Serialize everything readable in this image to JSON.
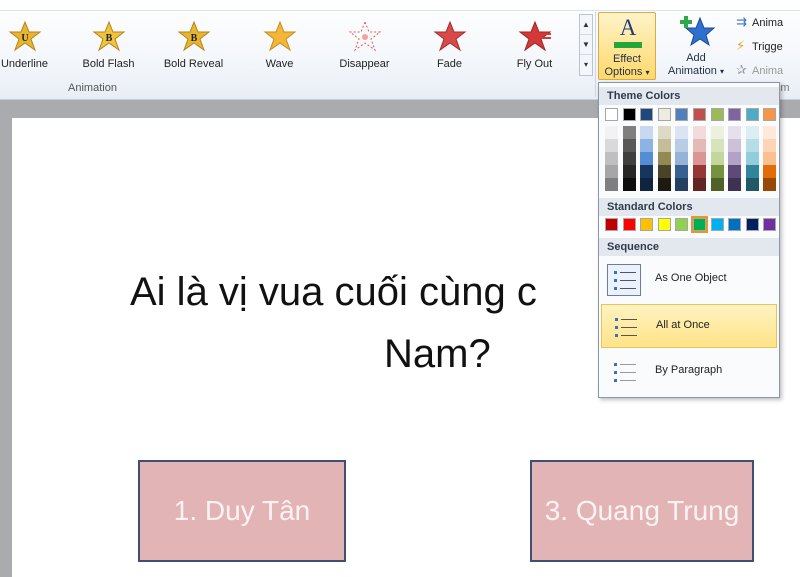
{
  "ribbon": {
    "animations": [
      {
        "label": "Underline",
        "icon": "underline-star-icon",
        "color": "#e8b530"
      },
      {
        "label": "Bold Flash",
        "icon": "bold-flash-star-icon",
        "color": "#e8b530"
      },
      {
        "label": "Bold Reveal",
        "icon": "bold-reveal-star-icon",
        "color": "#e8b530"
      },
      {
        "label": "Wave",
        "icon": "wave-star-icon",
        "color": "#f2b63b"
      },
      {
        "label": "Disappear",
        "icon": "disappear-star-icon",
        "color": "#e05a5a"
      },
      {
        "label": "Fade",
        "icon": "fade-star-icon",
        "color": "#d84a4a"
      },
      {
        "label": "Fly Out",
        "icon": "fly-out-star-icon",
        "color": "#d23a3a"
      }
    ],
    "group_label": "Animation",
    "effect_options": {
      "line1": "Effect",
      "line2": "Options"
    },
    "add_animation": {
      "line1": "Add",
      "line2": "Animation"
    },
    "side_commands": [
      {
        "label": "Anima",
        "icon": "animation-pane-icon",
        "disabled": false
      },
      {
        "label": "Trigge",
        "icon": "trigger-icon",
        "disabled": false
      },
      {
        "label": "Anima",
        "icon": "animation-painter-icon",
        "disabled": true
      }
    ],
    "next_group_label": "m"
  },
  "slide": {
    "title_line1": "Ai là vị vua cuối cùng c",
    "title_line2": "Nam?",
    "answers": [
      "1. Duy Tân",
      "3. Quang Trung"
    ]
  },
  "dropdown": {
    "theme_colors_header": "Theme Colors",
    "theme_colors": [
      "#ffffff",
      "#000000",
      "#1f497d",
      "#eeece1",
      "#4f81bd",
      "#c0504d",
      "#9bbb59",
      "#8064a2",
      "#4bacc6",
      "#f79646"
    ],
    "theme_shades": [
      [
        "#f2f2f2",
        "#d9d9d9",
        "#bfbfbf",
        "#a6a6a6",
        "#7f7f7f"
      ],
      [
        "#7f7f7f",
        "#595959",
        "#3f3f3f",
        "#262626",
        "#0d0d0d"
      ],
      [
        "#c6d9f0",
        "#8db3e2",
        "#548dd4",
        "#17365d",
        "#0f243e"
      ],
      [
        "#ddd9c3",
        "#c4bd97",
        "#938953",
        "#494429",
        "#1d1b10"
      ],
      [
        "#dbe5f1",
        "#b8cce4",
        "#95b3d7",
        "#366092",
        "#244061"
      ],
      [
        "#f2dcdb",
        "#e5b9b7",
        "#d99694",
        "#953734",
        "#632423"
      ],
      [
        "#ebf1dd",
        "#d7e3bc",
        "#c3d69b",
        "#76923c",
        "#4f6128"
      ],
      [
        "#e5e0ec",
        "#ccc1d9",
        "#b2a2c7",
        "#5f497a",
        "#3f3151"
      ],
      [
        "#dbeef3",
        "#b7dde8",
        "#92cddc",
        "#31859b",
        "#205867"
      ],
      [
        "#fdeada",
        "#fbd5b5",
        "#fac08f",
        "#e36c09",
        "#974806"
      ]
    ],
    "standard_colors_header": "Standard Colors",
    "standard_colors": [
      "#c00000",
      "#ff0000",
      "#ffc000",
      "#ffff00",
      "#92d050",
      "#00b050",
      "#00b0f0",
      "#0070c0",
      "#002060",
      "#7030a0"
    ],
    "selected_standard_index": 5,
    "sequence_header": "Sequence",
    "sequence_items": [
      {
        "label": "As One Object",
        "icon": "as-one-object-icon",
        "selected": false
      },
      {
        "label": "All at Once",
        "icon": "all-at-once-icon",
        "selected": true
      },
      {
        "label": "By Paragraph",
        "icon": "by-paragraph-icon",
        "selected": false
      }
    ]
  }
}
